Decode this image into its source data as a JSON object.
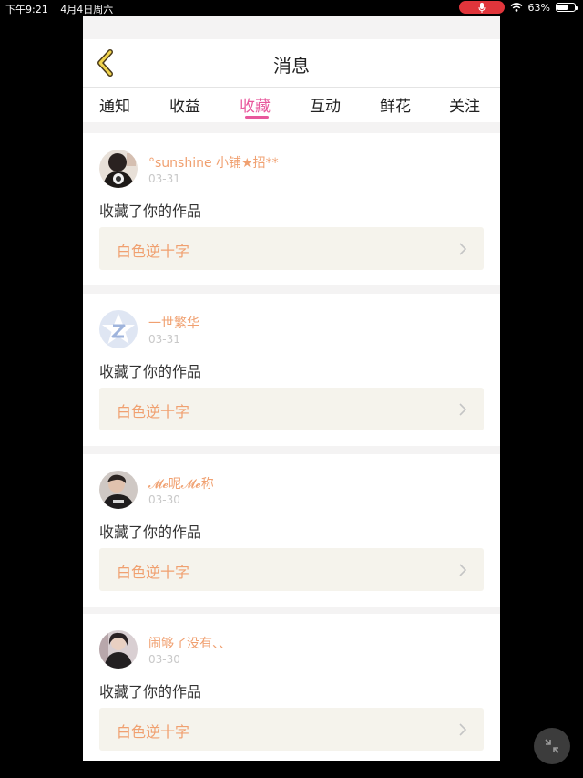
{
  "status_bar": {
    "time": "下午9:21",
    "date": "4月4日周六",
    "battery": "63%",
    "battery_level": 0.63
  },
  "header": {
    "title": "消息",
    "back_icon": "chevron-left-icon"
  },
  "tabs": [
    {
      "label": "通知"
    },
    {
      "label": "收益"
    },
    {
      "label": "收藏",
      "active": true
    },
    {
      "label": "互动"
    },
    {
      "label": "鲜花"
    },
    {
      "label": "关注"
    }
  ],
  "messages": [
    {
      "user": "°sunshine 小铺★招**",
      "date": "03-31",
      "action": "收藏了你的作品",
      "work": "白色逆十字"
    },
    {
      "user": "一世繁华",
      "date": "03-31",
      "action": "收藏了你的作品",
      "work": "白色逆十字"
    },
    {
      "user": "𝓜𝓮昵𝓜𝓮称",
      "date": "03-30",
      "action": "收藏了你的作品",
      "work": "白色逆十字"
    },
    {
      "user": "闹够了没有、、",
      "date": "03-30",
      "action": "收藏了你的作品",
      "work": "白色逆十字"
    }
  ],
  "colors": {
    "accent": "#e8589c",
    "username": "#f0a070",
    "work_bg": "#f5f3ec",
    "mic": "#e0353b"
  },
  "fab": {
    "icon": "collapse-arrows-icon"
  }
}
